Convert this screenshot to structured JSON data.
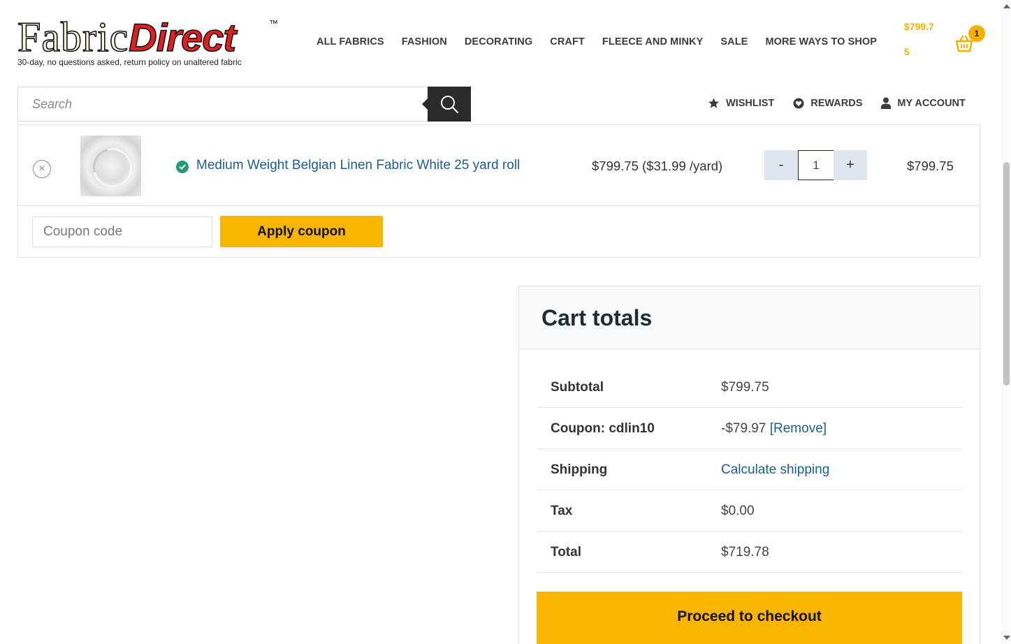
{
  "logo": {
    "part1": "Fabric",
    "part2": "Direct",
    "tm": "™",
    "tagline": "30-day, no questions asked, return policy on unaltered fabric"
  },
  "nav": {
    "items": [
      {
        "label": "ALL FABRICS"
      },
      {
        "label": "FASHION"
      },
      {
        "label": "DECORATING"
      },
      {
        "label": "CRAFT"
      },
      {
        "label": "FLEECE AND MINKY"
      },
      {
        "label": "SALE"
      },
      {
        "label": "MORE WAYS TO SHOP"
      }
    ]
  },
  "mini_cart": {
    "amount_line1": "$799.7",
    "amount_line2": "5",
    "count": "1",
    "icon": "basket-icon",
    "accent_color": "#f5b000"
  },
  "search": {
    "placeholder": "Search",
    "icon": "search-icon"
  },
  "util_links": {
    "wishlist": "WISHLIST",
    "rewards": "REWARDS",
    "account": "MY ACCOUNT"
  },
  "cart": {
    "item": {
      "name": "Medium Weight Belgian Linen Fabric White 25 yard roll",
      "unit_price": "$799.75 ($31.99 /yard)",
      "quantity": "1",
      "minus_label": "-",
      "plus_label": "+",
      "line_total": "$799.75",
      "remove_symbol": "×"
    },
    "coupon_placeholder": "Coupon code",
    "apply_label": "Apply coupon"
  },
  "totals": {
    "title": "Cart totals",
    "subtotal_label": "Subtotal",
    "subtotal_value": "$799.75",
    "coupon_label": "Coupon: cdlin10",
    "coupon_value": "-$79.97",
    "coupon_remove": "[Remove]",
    "shipping_label": "Shipping",
    "shipping_value": "Calculate shipping",
    "tax_label": "Tax",
    "tax_value": "$0.00",
    "total_label": "Total",
    "total_value": "$719.78",
    "checkout_label": "Proceed to checkout"
  },
  "colors": {
    "button_yellow": "#f7b500",
    "link_blue": "#1d5e8a",
    "stock_green": "#1e9e6a"
  }
}
